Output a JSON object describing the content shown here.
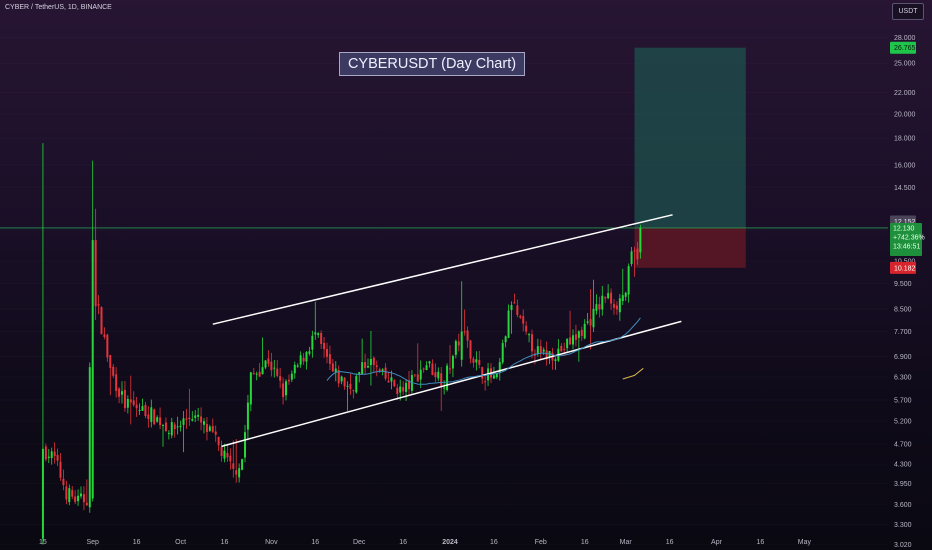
{
  "header": {
    "symbol_line": "CYBER / TetherUS, 1D, BINANCE",
    "currency": "USDT"
  },
  "title": "CYBERUSDT (Day Chart)",
  "price_axis": {
    "ticks": [
      "28.000",
      "25.000",
      "22.000",
      "20.000",
      "18.000",
      "16.000",
      "14.500",
      "12.000",
      "10.500",
      "9.500",
      "8.500",
      "7.700",
      "6.900",
      "6.300",
      "5.700",
      "5.200",
      "4.700",
      "4.300",
      "3.950",
      "3.600",
      "3.300",
      "3.020"
    ],
    "labels": {
      "target": "26.765",
      "entry": "12.152",
      "current": "12.130",
      "change": "+742.36%",
      "countdown": "13:46:51",
      "stop": "10.182"
    }
  },
  "time_axis": [
    "15",
    "Sep",
    "16",
    "Oct",
    "16",
    "Nov",
    "16",
    "Dec",
    "16",
    "2024",
    "16",
    "Feb",
    "16",
    "Mar",
    "16",
    "Apr",
    "16",
    "May"
  ],
  "colors": {
    "up": "#26d93a",
    "down": "#e5343c",
    "channel": "#ffffff",
    "ma_blue": "#3f8fbf",
    "ma_orange": "#d8b648",
    "target_zone": "#1e5550",
    "stop_zone": "#5f1724",
    "price_line": "#26b55a"
  },
  "chart_data": {
    "type": "candlestick",
    "symbol": "CYBER / TetherUS",
    "interval": "1D",
    "exchange": "BINANCE",
    "title": "CYBERUSDT (Day Chart)",
    "y_scale": "log",
    "ylim": [
      2.95,
      33
    ],
    "x_range": [
      "2023-08-14",
      "2024-05-20"
    ],
    "key_points": [
      {
        "x": "2023-08-15",
        "high": 17.6,
        "low": 3.02
      },
      {
        "x": "2023-09-01",
        "high": 16.3,
        "close": 11.5
      },
      {
        "x": "2023-10-19",
        "low": 4.05
      },
      {
        "x": "2024-01-05",
        "high": 9.6
      },
      {
        "x": "2024-03-06",
        "close": 12.13
      }
    ],
    "current_price": 12.13,
    "change_pct": "+742.36%",
    "position": {
      "side": "long",
      "entry": 12.152,
      "target": 26.765,
      "stop": 10.182
    },
    "channel": {
      "lower": [
        [
          "2023-10-15",
          4.65
        ],
        [
          "2024-03-20",
          8.05
        ]
      ],
      "upper": [
        [
          "2023-10-12",
          7.95
        ],
        [
          "2024-03-17",
          12.85
        ]
      ]
    }
  }
}
